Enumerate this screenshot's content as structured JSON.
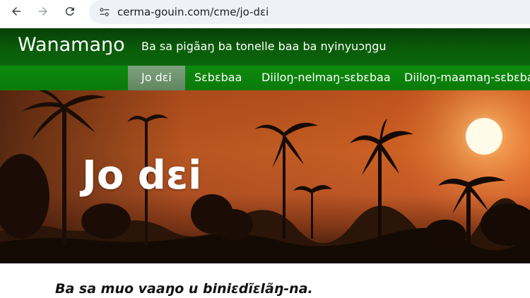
{
  "browser": {
    "url": "cerma-gouin.com/cme/jo-dɛi",
    "back_icon": "arrow-left-icon",
    "forward_icon": "arrow-right-icon",
    "reload_icon": "reload-icon",
    "site_info_icon": "tune-icon"
  },
  "header": {
    "logo": "Wanamaŋo",
    "tagline": "Ba sa pigãaŋ ba tonelle baa ba nyinyuɔŋgu"
  },
  "nav": {
    "items": [
      {
        "label": "Jo dɛi",
        "active": true
      },
      {
        "label": "Sɛbɛbaa",
        "active": false
      },
      {
        "label": "Diiloŋ-nelmaŋ-sɛbɛbaa",
        "active": false
      },
      {
        "label": "Diiloŋ-maamaŋ-sɛbɛbaa",
        "active": false
      }
    ]
  },
  "hero": {
    "title": "Jo dɛi"
  },
  "content": {
    "intro": "Ba sa muo vaaŋo u biniɛdĩɛlãŋ-na."
  },
  "colors": {
    "header_dark_green": "#063f06",
    "nav_green": "#0d8a0d",
    "active_tab": "#6f956f",
    "sunset_orange": "#e06a28"
  }
}
